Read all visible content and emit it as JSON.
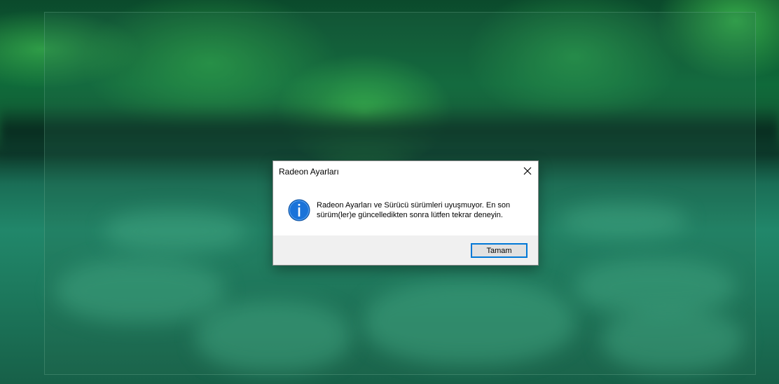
{
  "dialog": {
    "title": "Radeon Ayarları",
    "message": "Radeon Ayarları ve Sürücü sürümleri uyuşmuyor. En son sürüm(ler)e güncelledikten sonra lütfen tekrar deneyin.",
    "icon": "info-icon",
    "close_icon": "close-icon",
    "ok_label": "Tamam"
  },
  "colors": {
    "accent": "#0078d7",
    "info_icon": "#1a73d9",
    "footer_bg": "#f0f0f0"
  }
}
